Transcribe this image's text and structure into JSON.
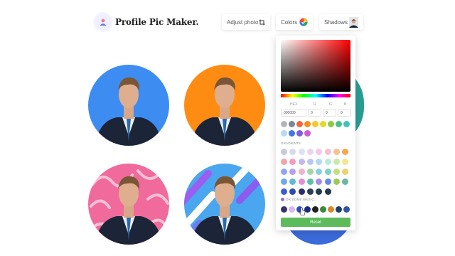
{
  "brand": {
    "title": "Profile Pic Maker."
  },
  "nav": {
    "adjust_label": "Adjust photo",
    "colors_label": "Colors",
    "shadows_label": "Shadows"
  },
  "picker": {
    "hex_header": "HEX",
    "r_header": "R",
    "g_header": "G",
    "b_header": "B",
    "hex_value": "000000",
    "r_value": "0",
    "g_value": "0",
    "b_value": "0",
    "gradients_label": "GRADIENTS",
    "magic_label": "OR SOME MAGIC...",
    "reset_label": "Reset",
    "solid_colors": [
      "#b4b4b8",
      "#7a8797",
      "#f2653f",
      "#f58f21",
      "#f5c727",
      "#e2d82d",
      "#8bcb3d",
      "#46c183",
      "#3cc2c0",
      "#b8d8f4",
      "#3f77e8",
      "#7e5ce6",
      "#d05ad6"
    ],
    "gradient_rows": [
      [
        "#c7c9d6",
        "#d9d9ee",
        "#dfe1f2",
        "#e7d6f0",
        "#f2c9e7",
        "#f8bfd0",
        "#f7c08d",
        "#f8a64d"
      ],
      [
        "#f4a3a8",
        "#f69bbd",
        "#c7b7f0",
        "#b7c8f6",
        "#b2d8f2",
        "#b8ecd9",
        "#c6eda6",
        "#f6e58b"
      ],
      [
        "#8fa5f2",
        "#b99ff0",
        "#f0b3ca",
        "#9fd7a4",
        "#89cfe0",
        "#80d1c4",
        "#c0e07a",
        "#f0d06a"
      ],
      [
        "#6fa7ea",
        "#62b8d6",
        "#e38fd1",
        "#58c1a6",
        "#a88ce8",
        "#5d8de4",
        "#9acb55",
        "#6bb5a4"
      ],
      [
        "#3b5fd0",
        "#2f4ab0",
        "#2b2f66",
        "#2a3e55",
        "#1f3a4a",
        "#243a4a"
      ]
    ],
    "magic_swatches": [
      "#38306b",
      "#d8b7ea",
      "#2a4cc4",
      "#1b2a88",
      "#212121",
      "#3a8a3a",
      "#d9892b",
      "#1e3d6b",
      "#3253a8"
    ]
  }
}
